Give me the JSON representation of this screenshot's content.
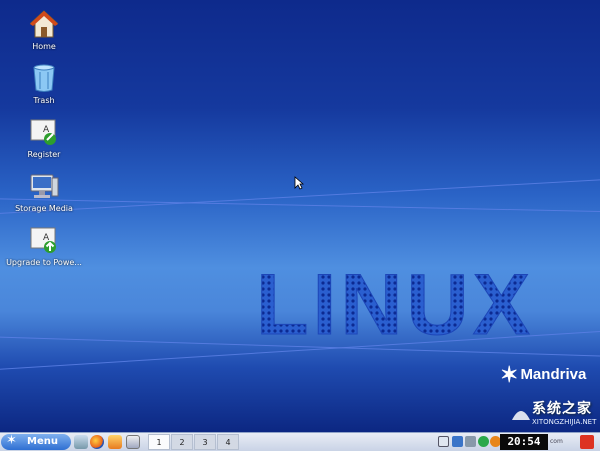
{
  "desktop": {
    "icons": [
      {
        "label": "Home",
        "icon": "home-icon"
      },
      {
        "label": "Trash",
        "icon": "trash-icon"
      },
      {
        "label": "Register",
        "icon": "register-icon"
      },
      {
        "label": "Storage Media",
        "icon": "storage-media-icon"
      },
      {
        "label": "Upgrade to Powe...",
        "icon": "upgrade-icon"
      }
    ],
    "wallpaper_text": "LINUX",
    "brand": "Mandriva",
    "watermark": {
      "cn": "系统之家",
      "url": "XITONGZHIJIA.NET"
    }
  },
  "taskbar": {
    "menu_label": "Menu",
    "workspaces": [
      "1",
      "2",
      "3",
      "4"
    ],
    "active_workspace": "1",
    "clock": "20:54",
    "tray_text": "com"
  },
  "colors": {
    "wallpaper_top": "#0e2a8c",
    "wallpaper_mid": "#4f8fe0",
    "taskbar_bg": "#d9e0ee",
    "menu_button": "#2f6fd2"
  }
}
